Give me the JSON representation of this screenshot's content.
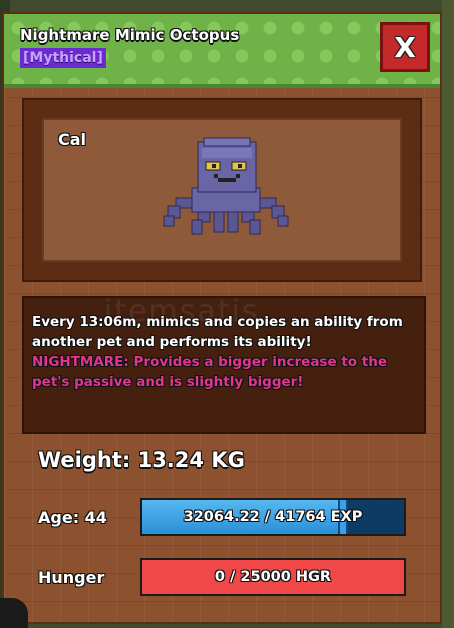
{
  "window": {
    "title": "Nightmare Mimic Octopus",
    "rarity": "[Mythical]",
    "close_label": "X"
  },
  "pet": {
    "name": "Cal"
  },
  "description": {
    "ability_text": "Every 13:06m, mimics and copies an ability from another pet and performs its ability!",
    "mutation_label": "NIGHTMARE:",
    "mutation_text": "Provides a bigger increase to the pet's passive and is slightly bigger!"
  },
  "watermark": "itemsatis",
  "stats": {
    "weight_text": "Weight: 13.24 KG",
    "age_label": "Age: 44",
    "exp_text": "32064.22 / 41764 EXP",
    "exp_fraction": 0.7677,
    "hunger_label": "Hunger",
    "hunger_text": "0 / 25000 HGR",
    "hunger_fraction": 0
  },
  "colors": {
    "header_green": "#6fb247",
    "frame_brown": "#8c5230",
    "rarity_purple": "#6a2bd0",
    "mutation_pink": "#e2358f",
    "exp_blue": "#2a8fd8",
    "hunger_red": "#f04848",
    "close_red": "#c42a2a"
  },
  "icons": {
    "close": "close-icon",
    "pet": "octopus-pet-image"
  }
}
